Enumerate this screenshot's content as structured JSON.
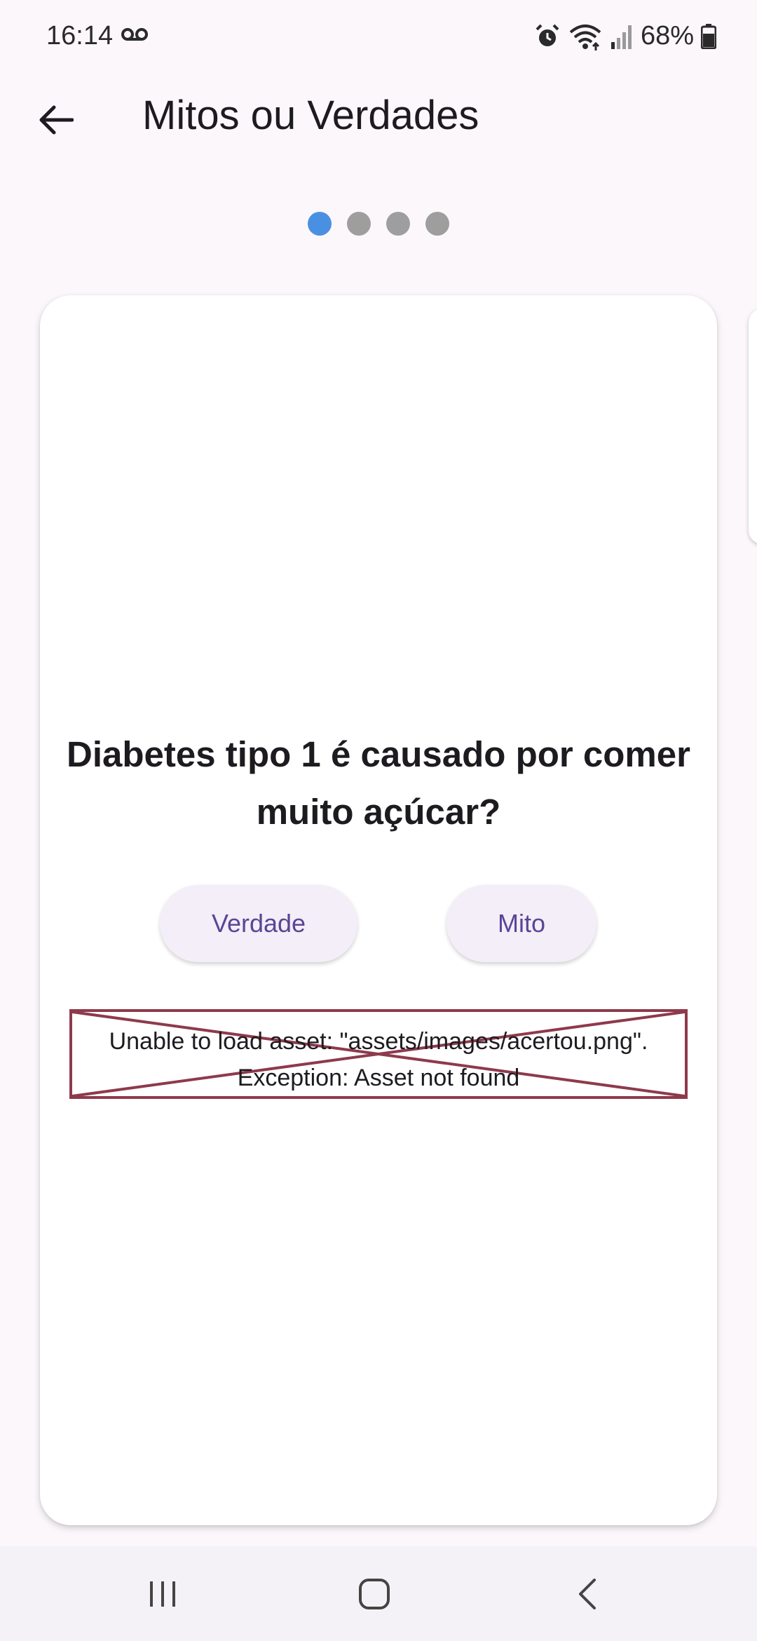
{
  "status_bar": {
    "time": "16:14",
    "battery": "68%",
    "icons": [
      "voicemail-icon",
      "alarm-icon",
      "wifi-icon",
      "signal-icon",
      "battery-icon"
    ]
  },
  "app_bar": {
    "title": "Mitos ou Verdades",
    "back_icon": "arrow-back-icon"
  },
  "page_indicator": {
    "count": 4,
    "active_index": 0,
    "active_color": "#4a90e2",
    "inactive_color": "#9e9e9e"
  },
  "card": {
    "question": "Diabetes tipo 1 é causado por comer muito açúcar?",
    "buttons": {
      "truth_label": "Verdade",
      "myth_label": "Mito"
    },
    "image_error": {
      "line1": "Unable to load asset: \"assets/images/acertou.png\".",
      "line2": "Exception: Asset not found",
      "border_color": "#8e3a4c"
    }
  },
  "nav_bar": {
    "icons": [
      "recent-apps-icon",
      "home-icon",
      "back-icon"
    ]
  }
}
